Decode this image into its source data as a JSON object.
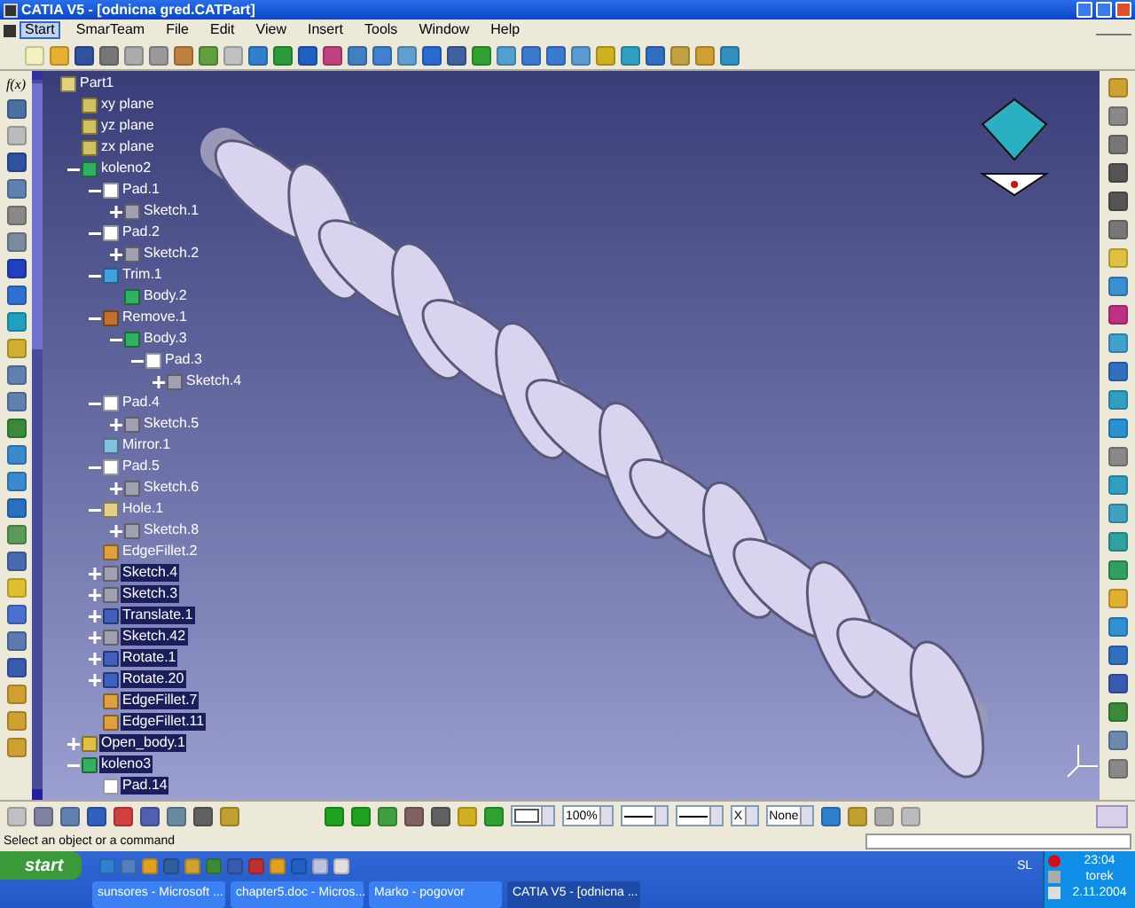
{
  "window": {
    "title": "CATIA V5 - [odnicna gred.CATPart]"
  },
  "menu": [
    {
      "label": "Start",
      "selected": true
    },
    {
      "label": "SmarTeam",
      "selected": false
    },
    {
      "label": "File",
      "selected": false
    },
    {
      "label": "Edit",
      "selected": false
    },
    {
      "label": "View",
      "selected": false
    },
    {
      "label": "Insert",
      "selected": false
    },
    {
      "label": "Tools",
      "selected": false
    },
    {
      "label": "Window",
      "selected": false
    },
    {
      "label": "Help",
      "selected": false
    }
  ],
  "left_toolbar": {
    "formula_button": "f(x)"
  },
  "tree": [
    {
      "label": "Part1",
      "kind": "part",
      "selected": false,
      "children": [
        {
          "label": "xy plane",
          "kind": "plane",
          "selected": false
        },
        {
          "label": "yz plane",
          "kind": "plane",
          "selected": false
        },
        {
          "label": "zx plane",
          "kind": "plane",
          "selected": false
        },
        {
          "label": "koleno2",
          "kind": "body",
          "selected": false,
          "expanded": true,
          "children": [
            {
              "label": "Pad.1",
              "kind": "pad",
              "selected": false,
              "expanded": true,
              "children": [
                {
                  "label": "Sketch.1",
                  "kind": "sketch",
                  "selected": false,
                  "expanded": false
                }
              ]
            },
            {
              "label": "Pad.2",
              "kind": "pad",
              "selected": false,
              "expanded": true,
              "children": [
                {
                  "label": "Sketch.2",
                  "kind": "sketch",
                  "selected": false,
                  "expanded": false
                }
              ]
            },
            {
              "label": "Trim.1",
              "kind": "trim",
              "selected": false,
              "expanded": true,
              "children": [
                {
                  "label": "Body.2",
                  "kind": "body",
                  "selected": false
                }
              ]
            },
            {
              "label": "Remove.1",
              "kind": "remove",
              "selected": false,
              "expanded": true,
              "children": [
                {
                  "label": "Body.3",
                  "kind": "body",
                  "selected": false,
                  "expanded": true,
                  "children": [
                    {
                      "label": "Pad.3",
                      "kind": "pad",
                      "selected": false,
                      "expanded": true,
                      "children": [
                        {
                          "label": "Sketch.4",
                          "kind": "sketch",
                          "selected": false,
                          "expanded": false
                        }
                      ]
                    }
                  ]
                }
              ]
            },
            {
              "label": "Pad.4",
              "kind": "pad",
              "selected": false,
              "expanded": true,
              "children": [
                {
                  "label": "Sketch.5",
                  "kind": "sketch",
                  "selected": false,
                  "expanded": false
                }
              ]
            },
            {
              "label": "Mirror.1",
              "kind": "mirror",
              "selected": false
            },
            {
              "label": "Pad.5",
              "kind": "pad",
              "selected": false,
              "expanded": true,
              "children": [
                {
                  "label": "Sketch.6",
                  "kind": "sketch",
                  "selected": false,
                  "expanded": false
                }
              ]
            },
            {
              "label": "Hole.1",
              "kind": "hole",
              "selected": false,
              "expanded": true,
              "children": [
                {
                  "label": "Sketch.8",
                  "kind": "sketch",
                  "selected": false,
                  "expanded": false
                }
              ]
            },
            {
              "label": "EdgeFillet.2",
              "kind": "fillet",
              "selected": false
            },
            {
              "label": "Sketch.4",
              "kind": "sketch",
              "selected": true,
              "expanded": false
            },
            {
              "label": "Sketch.3",
              "kind": "sketch",
              "selected": true,
              "expanded": false
            },
            {
              "label": "Translate.1",
              "kind": "transform",
              "selected": true,
              "expanded": false
            },
            {
              "label": "Sketch.42",
              "kind": "sketch",
              "selected": true,
              "expanded": false
            },
            {
              "label": "Rotate.1",
              "kind": "transform",
              "selected": true,
              "expanded": false
            },
            {
              "label": "Rotate.20",
              "kind": "transform",
              "selected": true,
              "expanded": false
            },
            {
              "label": "EdgeFillet.7",
              "kind": "fillet",
              "selected": true
            },
            {
              "label": "EdgeFillet.11",
              "kind": "fillet",
              "selected": true
            }
          ]
        },
        {
          "label": "Open_body.1",
          "kind": "openbody",
          "selected": true,
          "expanded": false
        },
        {
          "label": "koleno3",
          "kind": "body",
          "selected": true,
          "expanded": true,
          "children": [
            {
              "label": "Pad.14",
              "kind": "pad",
              "selected": true
            }
          ]
        }
      ]
    }
  ],
  "graphic_properties": [
    {
      "kind": "color"
    },
    {
      "kind": "text",
      "value": "100%"
    },
    {
      "kind": "line"
    },
    {
      "kind": "line"
    },
    {
      "kind": "text",
      "value": "X"
    },
    {
      "kind": "text",
      "value": "None"
    }
  ],
  "status_bar": {
    "prompt": "Select an object or a command"
  },
  "taskbar": {
    "start": "start",
    "tasks": [
      {
        "label": "sunsores - Microsoft ...",
        "selected": false
      },
      {
        "label": "chapter5.doc - Micros...",
        "selected": false
      },
      {
        "label": "Marko - pogovor",
        "selected": false
      },
      {
        "label": "CATIA V5 - [odnicna ...",
        "selected": true
      }
    ],
    "language": "SL",
    "time": "23:04",
    "day": "torek",
    "date": "2.11.2004"
  }
}
